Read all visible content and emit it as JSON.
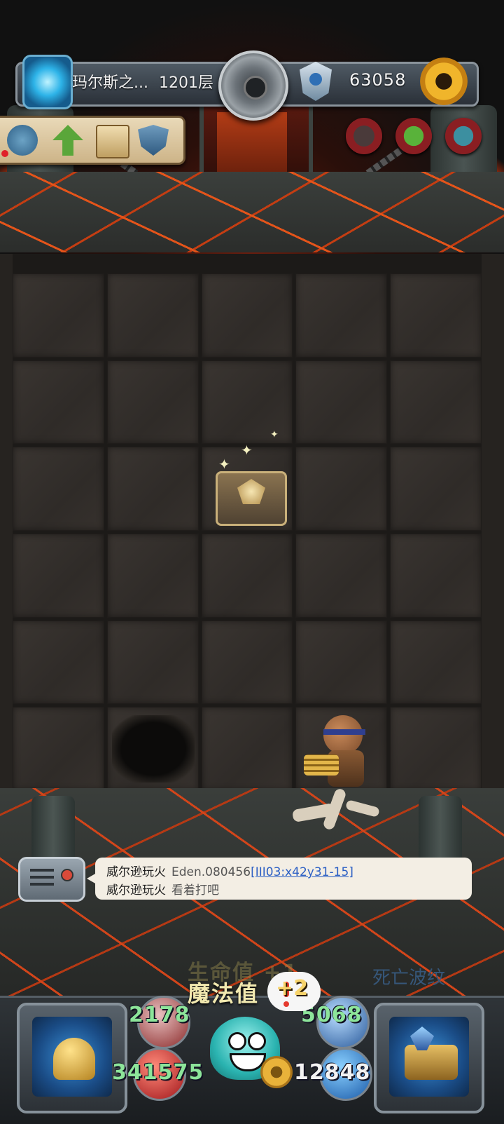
{
  "header": {
    "floor_name": "玛尔斯之...",
    "floor_number": "1201层",
    "gold": "63058"
  },
  "item_panel": {
    "items": [
      "turtle-shell-icon",
      "up-arrow-icon",
      "scroll-icon",
      "shield-icon"
    ]
  },
  "status_buttons": [
    "armor-buff-icon",
    "green-monster-icon",
    "red-monster-icon"
  ],
  "chat": {
    "line1": {
      "name": "威尔逊玩火",
      "text": "Eden.080456",
      "link": "[III03:x42y31-15]"
    },
    "line2": {
      "name": "威尔逊玩火",
      "text": "看着打吧"
    }
  },
  "floating": {
    "hp_gain": "生命值 +1",
    "mp_gain": "魔法值",
    "mp_amount": "+2",
    "skill_name": "死亡波纹"
  },
  "hud": {
    "attack": "2178",
    "defense": "5068",
    "hp": "341575",
    "gold": "12848"
  },
  "colors": {
    "lava": "#e4541a",
    "stat_green": "#8de59a",
    "header_bg": "#2a3038",
    "gold_gear": "#f0b52b"
  }
}
